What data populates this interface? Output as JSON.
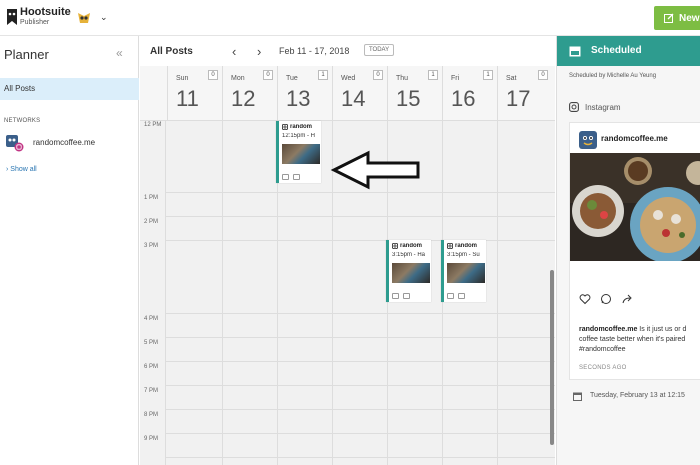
{
  "header": {
    "brand": "Hootsuite",
    "brand_sub": "Publisher",
    "new_post_label": "New P"
  },
  "sidebar": {
    "title": "Planner",
    "collapse_icon": "double-chevron-left-icon",
    "all_posts": "All Posts",
    "networks_label": "NETWORKS",
    "network_name": "randomcoffee.me",
    "show_all": "Show all"
  },
  "calendar": {
    "title": "All Posts",
    "date_range": "Feb 11 - 17, 2018",
    "today_label": "TODAY",
    "days": [
      {
        "name": "Sun",
        "num": "11",
        "count": "0"
      },
      {
        "name": "Mon",
        "num": "12",
        "count": "0"
      },
      {
        "name": "Tue",
        "num": "13",
        "count": "1"
      },
      {
        "name": "Wed",
        "num": "14",
        "count": "0"
      },
      {
        "name": "Thu",
        "num": "15",
        "count": "1"
      },
      {
        "name": "Fri",
        "num": "16",
        "count": "1"
      },
      {
        "name": "Sat",
        "num": "17",
        "count": "0"
      }
    ],
    "times": [
      "12 PM",
      "1 PM",
      "2 PM",
      "3 PM",
      "4 PM",
      "5 PM",
      "6 PM",
      "7 PM",
      "8 PM",
      "9 PM"
    ],
    "posts": [
      {
        "account": "random",
        "time": "12:15pm - H"
      },
      {
        "account": "random",
        "time": "3:15pm - Ha"
      },
      {
        "account": "random",
        "time": "3:15pm - Su"
      }
    ]
  },
  "panel": {
    "title": "Scheduled",
    "scheduled_by": "Scheduled by Michelle Au Yeung",
    "network_label": "Instagram",
    "account": "randomcoffee.me",
    "caption_account": "randomcoffee.me",
    "caption_text": " Is it just us or d coffee taste better when it's paired #randomcoffee",
    "time_ago": "SECONDS AGO",
    "scheduled_date": "Tuesday, February 13 at 12:15"
  },
  "colors": {
    "accent_teal": "#2e9c8f",
    "new_post_green": "#7dbd43",
    "selected_nav": "#dbeefa",
    "link_blue": "#2a76b2"
  }
}
